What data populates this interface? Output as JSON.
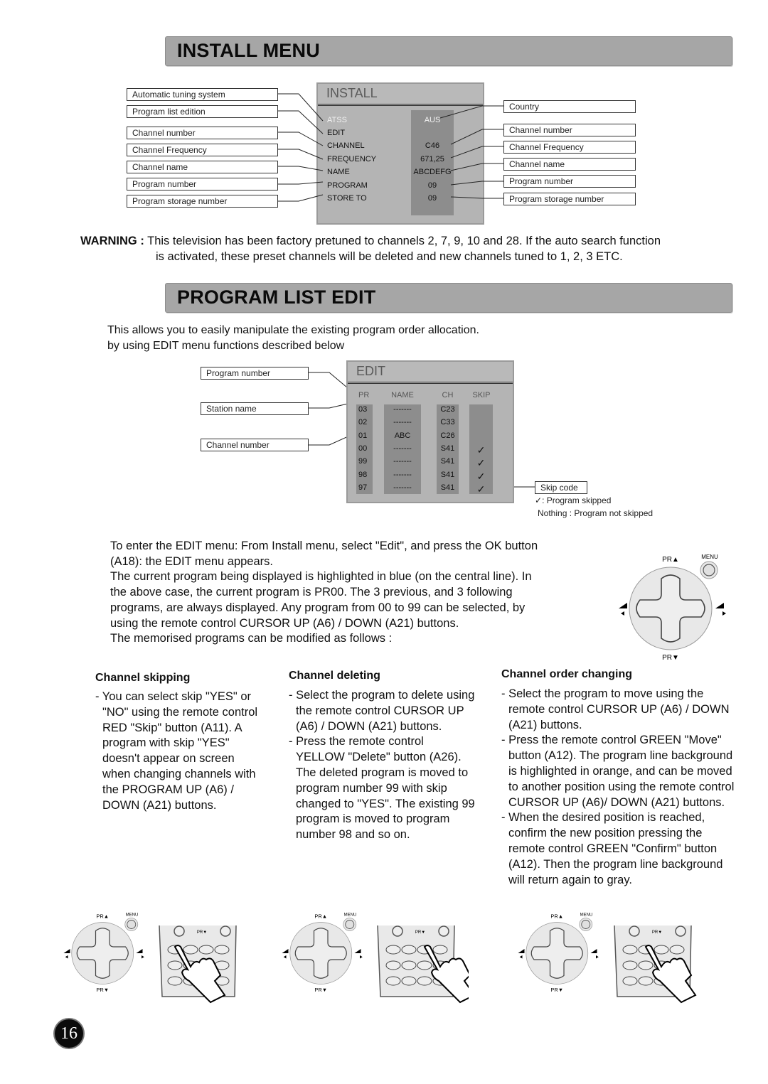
{
  "install_menu": {
    "section_title": "INSTALL MENU",
    "osd": {
      "title": "INSTALL",
      "rows": [
        {
          "label": "ATSS",
          "value": "AUS",
          "highlighted": true
        },
        {
          "label": "EDIT",
          "value": ""
        },
        {
          "label": "CHANNEL",
          "value": "C46"
        },
        {
          "label": "FREQUENCY",
          "value": "671,25"
        },
        {
          "label": "NAME",
          "value": "ABCDEFG"
        },
        {
          "label": "PROGRAM",
          "value": "09"
        },
        {
          "label": "STORE TO",
          "value": "09"
        }
      ]
    },
    "left_callouts": [
      "Automatic tuning system",
      "Program list edition",
      "Channel number",
      "Channel Frequency",
      "Channel name",
      "Program number",
      "Program storage number"
    ],
    "right_callouts": [
      "Country",
      "Channel number",
      "Channel Frequency",
      "Channel name",
      "Program number",
      "Program storage number"
    ]
  },
  "warning": {
    "label": "WARNING :",
    "line1": "This television has been factory pretuned to channels 2, 7, 9, 10 and 28. If the auto search function",
    "line2": "is activated, these preset channels will be deleted and new channels tuned to 1, 2, 3 ETC."
  },
  "program_list_edit": {
    "section_title": "PROGRAM LIST EDIT",
    "intro_line1": "This allows you to easily manipulate the existing program order allocation.",
    "intro_line2": "by using EDIT menu functions described below",
    "osd": {
      "title": "EDIT",
      "headers": {
        "pr": "PR",
        "name": "NAME",
        "ch": "CH",
        "skip": "SKIP"
      },
      "rows": [
        {
          "pr": "03",
          "name": "-------",
          "ch": "C23",
          "skip": false
        },
        {
          "pr": "02",
          "name": "-------",
          "ch": "C33",
          "skip": false
        },
        {
          "pr": "01",
          "name": "ABC",
          "ch": "C26",
          "skip": false
        },
        {
          "pr": "00",
          "name": "-------",
          "ch": "S41",
          "skip": true
        },
        {
          "pr": "99",
          "name": "-------",
          "ch": "S41",
          "skip": true
        },
        {
          "pr": "98",
          "name": "-------",
          "ch": "S41",
          "skip": true
        },
        {
          "pr": "97",
          "name": "-------",
          "ch": "S41",
          "skip": true
        }
      ]
    },
    "left_callouts": [
      "Program number",
      "Station name",
      "Channel number"
    ],
    "skip_code": {
      "label": "Skip code",
      "skipped": ": Program skipped",
      "not_skipped": "Nothing : Program not skipped"
    },
    "instructions": [
      "To enter the EDIT menu: From Install menu, select \"Edit\", and press the OK button",
      "(A18): the EDIT menu appears.",
      "The current program being displayed is highlighted in blue (on the central line). In",
      "the above case, the current program is PR00. The 3 previous, and 3 following",
      "programs, are always displayed. Any program from 00 to 99 can be selected, by",
      "using the remote control CURSOR UP (A6) / DOWN (A21) buttons.",
      "The memorised programs can be modified as follows :"
    ]
  },
  "remote": {
    "pr_up": "PR▲",
    "pr_down": "PR▼",
    "menu": "MENU"
  },
  "columns": [
    {
      "heading": "Channel skipping",
      "items": [
        "- You can select skip \"YES\" or \"NO\" using the remote control RED \"Skip\" button (A11). A program with skip \"YES\" doesn't appear on screen when changing channels with the PROGRAM UP (A6) / DOWN (A21) buttons."
      ]
    },
    {
      "heading": "Channel deleting",
      "items": [
        "- Select the program to delete using the remote control CURSOR UP (A6) / DOWN (A21) buttons.",
        "- Press the remote control YELLOW \"Delete\" button (A26). The deleted program is moved to program number 99 with skip changed to \"YES\". The existing 99 program is moved to program number 98 and so on."
      ]
    },
    {
      "heading": "Channel order changing",
      "items": [
        "- Select the program to move using the remote control CURSOR UP (A6) / DOWN (A21) buttons.",
        "- Press the remote control GREEN \"Move\" button (A12). The program line background is highlighted in orange, and can be moved to another position using the remote control CURSOR UP (A6)/ DOWN (A21) buttons.",
        "- When the desired position is reached, confirm the new position pressing the remote control GREEN \"Confirm\" button (A12). Then the program line background will return again to gray."
      ]
    }
  ],
  "page_number": "16"
}
